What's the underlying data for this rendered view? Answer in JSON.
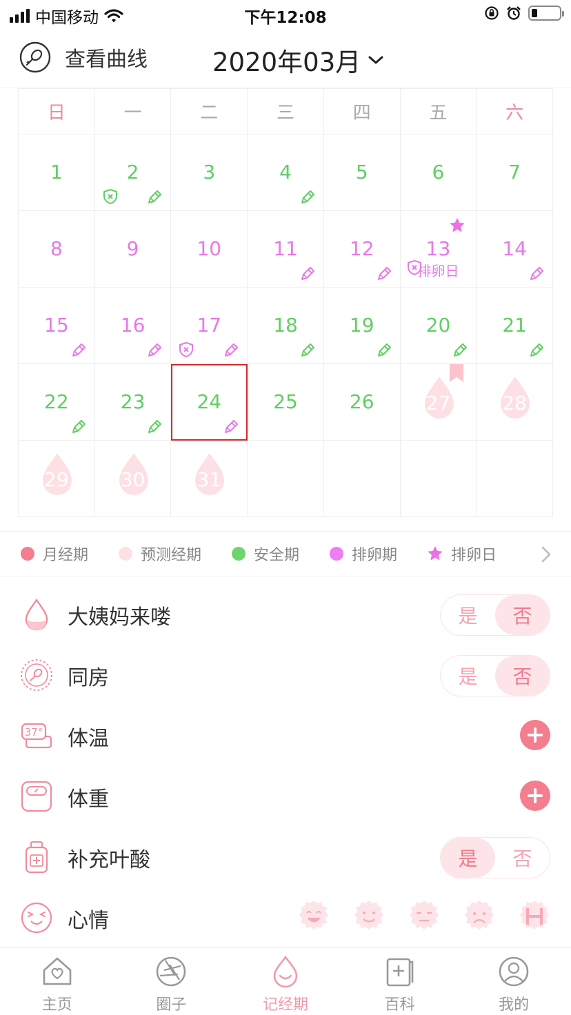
{
  "status_bar": {
    "carrier": "中国移动",
    "time": "下午12:08"
  },
  "header": {
    "curve_label": "查看曲线",
    "month_label": "2020年03月"
  },
  "calendar": {
    "weekdays": [
      "日",
      "一",
      "二",
      "三",
      "四",
      "五",
      "六"
    ],
    "ovulation_day_label": "排卵日"
  },
  "legend": {
    "items": [
      {
        "label": "月经期",
        "color": "#f47d8e"
      },
      {
        "label": "预测经期",
        "color": "#fde0e4"
      },
      {
        "label": "安全期",
        "color": "#6fd46f"
      },
      {
        "label": "排卵期",
        "color": "#ee7cf2"
      },
      {
        "label": "排卵日",
        "color": "#ee6fe6"
      }
    ]
  },
  "records": {
    "period": {
      "label": "大姨妈来喽",
      "yes": "是",
      "no": "否",
      "selected": "否"
    },
    "intercourse": {
      "label": "同房",
      "yes": "是",
      "no": "否",
      "selected": "否"
    },
    "temperature": {
      "label": "体温",
      "icon_text": "37°"
    },
    "weight": {
      "label": "体重"
    },
    "folic_acid": {
      "label": "补充叶酸",
      "yes": "是",
      "no": "否",
      "selected": "是"
    },
    "mood": {
      "label": "心情"
    }
  },
  "bottom_nav": [
    {
      "label": "主页",
      "icon": "home-heart-icon"
    },
    {
      "label": "圈子",
      "icon": "aperture-icon"
    },
    {
      "label": "记经期",
      "icon": "drop-smile-icon",
      "active": true
    },
    {
      "label": "百科",
      "icon": "book-plus-icon"
    },
    {
      "label": "我的",
      "icon": "user-icon"
    }
  ],
  "colors": {
    "accent": "#f47d8e",
    "safe": "#5ecf62",
    "ovulation": "#e878e8",
    "predicted": "#fde0e4",
    "today_border": "#d6262b"
  }
}
